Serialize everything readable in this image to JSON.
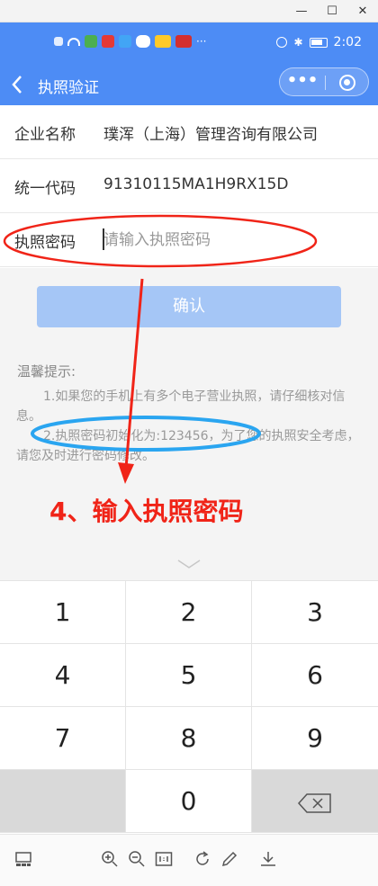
{
  "window": {
    "minimize": "—",
    "maximize": "☐",
    "close": "✕"
  },
  "status_bar": {
    "time": "2:02"
  },
  "nav": {
    "back_icon": "chevron-left-icon",
    "title": "执照验证",
    "more": "•••"
  },
  "form": {
    "company_label": "企业名称",
    "company_value": "璞浑（上海）管理咨询有限公司",
    "code_label": "统一代码",
    "code_value": "91310115MA1H9RX15D",
    "password_label": "执照密码",
    "password_placeholder": "请输入执照密码"
  },
  "confirm_button": "确认",
  "tips": {
    "title": "温馨提示:",
    "items": [
      "1.如果您的手机上有多个电子营业执照，请仔细核对信息。",
      "2.执照密码初始化为:123456，为了您的执照安全考虑，请您及时进行密码修改。"
    ]
  },
  "annotation": {
    "step_text": "4、输入执照密码",
    "color": "#f02418",
    "highlight_color": "#2aa5f0"
  },
  "keypad": {
    "keys": [
      "1",
      "2",
      "3",
      "4",
      "5",
      "6",
      "7",
      "8",
      "9",
      "0"
    ]
  },
  "colors": {
    "brand": "#4d8cf5",
    "button": "#a5c6f6"
  }
}
